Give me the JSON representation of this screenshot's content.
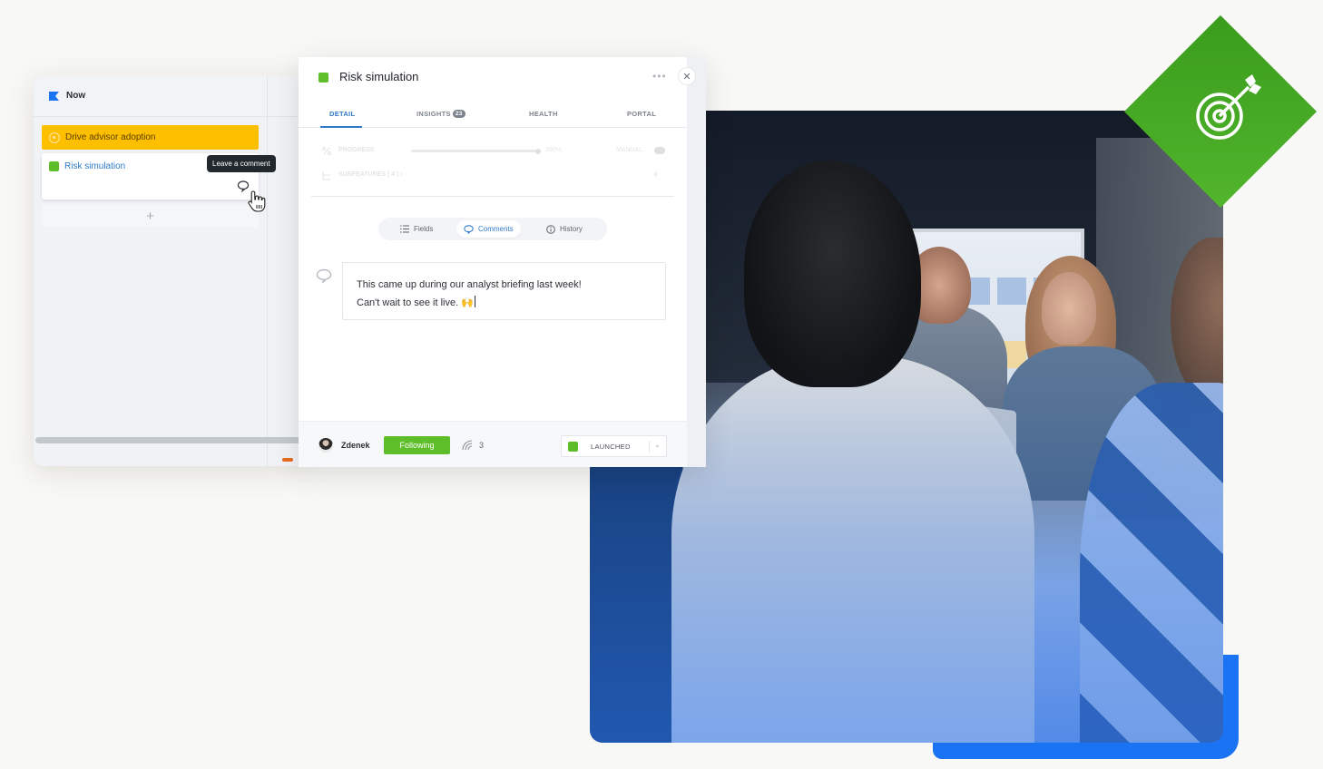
{
  "board": {
    "header_title": "Now",
    "goal_card": {
      "label": "Drive advisor adoption",
      "color": "#fdbf00"
    },
    "feature_card": {
      "label": "Risk simulation",
      "color": "#5ebe2a"
    },
    "add_card_label": "+",
    "tooltip": "Leave a comment"
  },
  "detail": {
    "title": "Risk simulation",
    "status_color": "#5ebe2a",
    "more_label": "•••",
    "close_label": "✕",
    "tabs": [
      {
        "label": "DETAIL",
        "active": true
      },
      {
        "label": "INSIGHTS",
        "badge": "23",
        "active": false
      },
      {
        "label": "HEALTH",
        "active": false
      },
      {
        "label": "PORTAL",
        "active": false
      }
    ],
    "progress": {
      "label": "PROGRESS",
      "value_text": "100%",
      "value": 1.0,
      "mode_label": "MANUAL"
    },
    "subfeatures": {
      "label": "SUBFEATURES ( 4 )  ›",
      "add_label": "+"
    },
    "segments": [
      {
        "label": "Fields",
        "icon": "list-icon",
        "active": false
      },
      {
        "label": "Comments",
        "icon": "comment-icon",
        "active": true
      },
      {
        "label": "History",
        "icon": "info-icon",
        "active": false
      }
    ],
    "comment": {
      "line1": "This came up during our analyst briefing last week!",
      "line2": "Can't wait to see it live. 🙌"
    },
    "footer": {
      "user_name": "Zdenek",
      "follow_label": "Following",
      "watchers_count": "3",
      "status_label": "LAUNCHED",
      "status_color": "#5ebe2a"
    }
  },
  "decor": {
    "badge_icon": "target-arrow-icon",
    "badge_color": "#44a822",
    "accent_color": "#1a73f2"
  }
}
